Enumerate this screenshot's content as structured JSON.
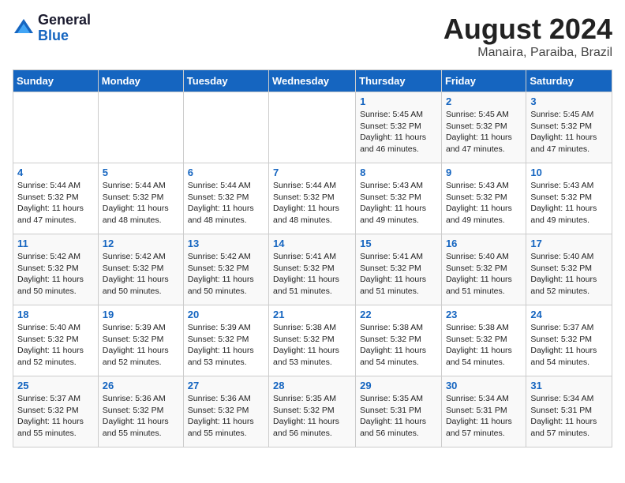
{
  "logo": {
    "general": "General",
    "blue": "Blue"
  },
  "title": "August 2024",
  "location": "Manaira, Paraiba, Brazil",
  "weekdays": [
    "Sunday",
    "Monday",
    "Tuesday",
    "Wednesday",
    "Thursday",
    "Friday",
    "Saturday"
  ],
  "weeks": [
    [
      {
        "day": "",
        "sunrise": "",
        "sunset": "",
        "daylight": ""
      },
      {
        "day": "",
        "sunrise": "",
        "sunset": "",
        "daylight": ""
      },
      {
        "day": "",
        "sunrise": "",
        "sunset": "",
        "daylight": ""
      },
      {
        "day": "",
        "sunrise": "",
        "sunset": "",
        "daylight": ""
      },
      {
        "day": "1",
        "sunrise": "Sunrise: 5:45 AM",
        "sunset": "Sunset: 5:32 PM",
        "daylight": "Daylight: 11 hours and 46 minutes."
      },
      {
        "day": "2",
        "sunrise": "Sunrise: 5:45 AM",
        "sunset": "Sunset: 5:32 PM",
        "daylight": "Daylight: 11 hours and 47 minutes."
      },
      {
        "day": "3",
        "sunrise": "Sunrise: 5:45 AM",
        "sunset": "Sunset: 5:32 PM",
        "daylight": "Daylight: 11 hours and 47 minutes."
      }
    ],
    [
      {
        "day": "4",
        "sunrise": "Sunrise: 5:44 AM",
        "sunset": "Sunset: 5:32 PM",
        "daylight": "Daylight: 11 hours and 47 minutes."
      },
      {
        "day": "5",
        "sunrise": "Sunrise: 5:44 AM",
        "sunset": "Sunset: 5:32 PM",
        "daylight": "Daylight: 11 hours and 48 minutes."
      },
      {
        "day": "6",
        "sunrise": "Sunrise: 5:44 AM",
        "sunset": "Sunset: 5:32 PM",
        "daylight": "Daylight: 11 hours and 48 minutes."
      },
      {
        "day": "7",
        "sunrise": "Sunrise: 5:44 AM",
        "sunset": "Sunset: 5:32 PM",
        "daylight": "Daylight: 11 hours and 48 minutes."
      },
      {
        "day": "8",
        "sunrise": "Sunrise: 5:43 AM",
        "sunset": "Sunset: 5:32 PM",
        "daylight": "Daylight: 11 hours and 49 minutes."
      },
      {
        "day": "9",
        "sunrise": "Sunrise: 5:43 AM",
        "sunset": "Sunset: 5:32 PM",
        "daylight": "Daylight: 11 hours and 49 minutes."
      },
      {
        "day": "10",
        "sunrise": "Sunrise: 5:43 AM",
        "sunset": "Sunset: 5:32 PM",
        "daylight": "Daylight: 11 hours and 49 minutes."
      }
    ],
    [
      {
        "day": "11",
        "sunrise": "Sunrise: 5:42 AM",
        "sunset": "Sunset: 5:32 PM",
        "daylight": "Daylight: 11 hours and 50 minutes."
      },
      {
        "day": "12",
        "sunrise": "Sunrise: 5:42 AM",
        "sunset": "Sunset: 5:32 PM",
        "daylight": "Daylight: 11 hours and 50 minutes."
      },
      {
        "day": "13",
        "sunrise": "Sunrise: 5:42 AM",
        "sunset": "Sunset: 5:32 PM",
        "daylight": "Daylight: 11 hours and 50 minutes."
      },
      {
        "day": "14",
        "sunrise": "Sunrise: 5:41 AM",
        "sunset": "Sunset: 5:32 PM",
        "daylight": "Daylight: 11 hours and 51 minutes."
      },
      {
        "day": "15",
        "sunrise": "Sunrise: 5:41 AM",
        "sunset": "Sunset: 5:32 PM",
        "daylight": "Daylight: 11 hours and 51 minutes."
      },
      {
        "day": "16",
        "sunrise": "Sunrise: 5:40 AM",
        "sunset": "Sunset: 5:32 PM",
        "daylight": "Daylight: 11 hours and 51 minutes."
      },
      {
        "day": "17",
        "sunrise": "Sunrise: 5:40 AM",
        "sunset": "Sunset: 5:32 PM",
        "daylight": "Daylight: 11 hours and 52 minutes."
      }
    ],
    [
      {
        "day": "18",
        "sunrise": "Sunrise: 5:40 AM",
        "sunset": "Sunset: 5:32 PM",
        "daylight": "Daylight: 11 hours and 52 minutes."
      },
      {
        "day": "19",
        "sunrise": "Sunrise: 5:39 AM",
        "sunset": "Sunset: 5:32 PM",
        "daylight": "Daylight: 11 hours and 52 minutes."
      },
      {
        "day": "20",
        "sunrise": "Sunrise: 5:39 AM",
        "sunset": "Sunset: 5:32 PM",
        "daylight": "Daylight: 11 hours and 53 minutes."
      },
      {
        "day": "21",
        "sunrise": "Sunrise: 5:38 AM",
        "sunset": "Sunset: 5:32 PM",
        "daylight": "Daylight: 11 hours and 53 minutes."
      },
      {
        "day": "22",
        "sunrise": "Sunrise: 5:38 AM",
        "sunset": "Sunset: 5:32 PM",
        "daylight": "Daylight: 11 hours and 54 minutes."
      },
      {
        "day": "23",
        "sunrise": "Sunrise: 5:38 AM",
        "sunset": "Sunset: 5:32 PM",
        "daylight": "Daylight: 11 hours and 54 minutes."
      },
      {
        "day": "24",
        "sunrise": "Sunrise: 5:37 AM",
        "sunset": "Sunset: 5:32 PM",
        "daylight": "Daylight: 11 hours and 54 minutes."
      }
    ],
    [
      {
        "day": "25",
        "sunrise": "Sunrise: 5:37 AM",
        "sunset": "Sunset: 5:32 PM",
        "daylight": "Daylight: 11 hours and 55 minutes."
      },
      {
        "day": "26",
        "sunrise": "Sunrise: 5:36 AM",
        "sunset": "Sunset: 5:32 PM",
        "daylight": "Daylight: 11 hours and 55 minutes."
      },
      {
        "day": "27",
        "sunrise": "Sunrise: 5:36 AM",
        "sunset": "Sunset: 5:32 PM",
        "daylight": "Daylight: 11 hours and 55 minutes."
      },
      {
        "day": "28",
        "sunrise": "Sunrise: 5:35 AM",
        "sunset": "Sunset: 5:32 PM",
        "daylight": "Daylight: 11 hours and 56 minutes."
      },
      {
        "day": "29",
        "sunrise": "Sunrise: 5:35 AM",
        "sunset": "Sunset: 5:31 PM",
        "daylight": "Daylight: 11 hours and 56 minutes."
      },
      {
        "day": "30",
        "sunrise": "Sunrise: 5:34 AM",
        "sunset": "Sunset: 5:31 PM",
        "daylight": "Daylight: 11 hours and 57 minutes."
      },
      {
        "day": "31",
        "sunrise": "Sunrise: 5:34 AM",
        "sunset": "Sunset: 5:31 PM",
        "daylight": "Daylight: 11 hours and 57 minutes."
      }
    ]
  ]
}
